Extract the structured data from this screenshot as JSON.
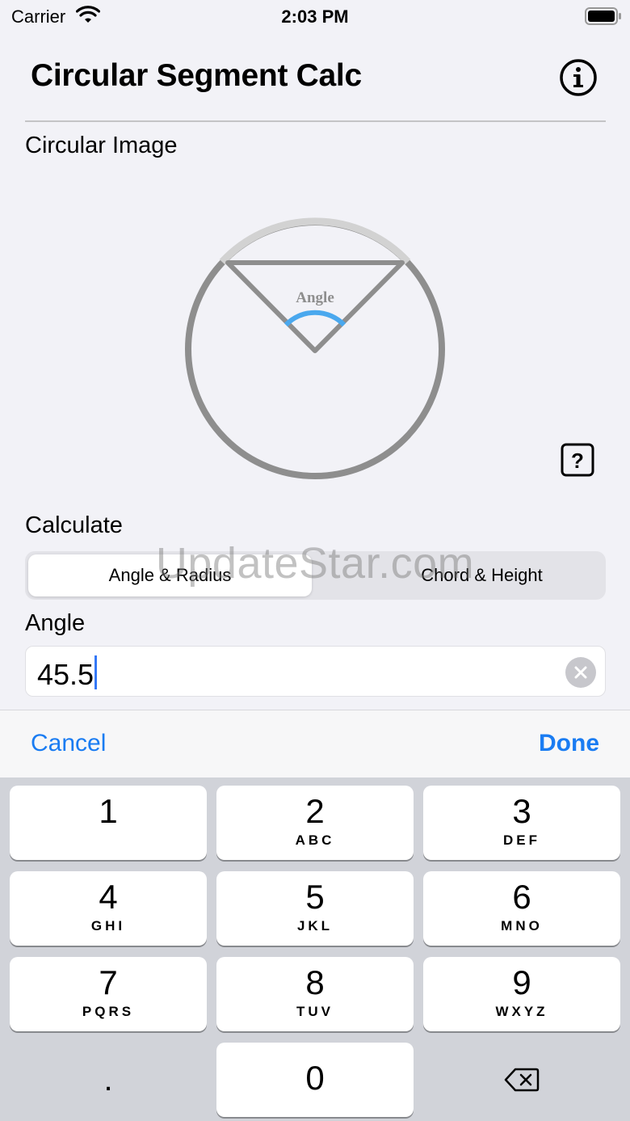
{
  "status": {
    "carrier": "Carrier",
    "time": "2:03 PM"
  },
  "header": {
    "title": "Circular Segment Calc",
    "info_icon": "info-icon"
  },
  "sections": {
    "image_label": "Circular Image",
    "calculate_label": "Calculate",
    "angle_label": "Angle"
  },
  "diagram": {
    "angle_label": "Angle",
    "arc_color": "#4aa8ee",
    "line_color": "#8e8e8e"
  },
  "help_icon": "question-mark-icon",
  "segmented": {
    "options": [
      "Angle & Radius",
      "Chord & Height"
    ],
    "selected": "Angle & Radius"
  },
  "watermark": "UpdateStar.com",
  "angle_input": {
    "value": "45.5"
  },
  "toolbar": {
    "cancel": "Cancel",
    "done": "Done",
    "accent": "#1a7cf2"
  },
  "keypad": {
    "keys": [
      {
        "num": "1",
        "letters": ""
      },
      {
        "num": "2",
        "letters": "ABC"
      },
      {
        "num": "3",
        "letters": "DEF"
      },
      {
        "num": "4",
        "letters": "GHI"
      },
      {
        "num": "5",
        "letters": "JKL"
      },
      {
        "num": "6",
        "letters": "MNO"
      },
      {
        "num": "7",
        "letters": "PQRS"
      },
      {
        "num": "8",
        "letters": "TUV"
      },
      {
        "num": "9",
        "letters": "WXYZ"
      }
    ],
    "decimal": ".",
    "zero": "0",
    "delete_icon": "delete-backspace-icon"
  }
}
